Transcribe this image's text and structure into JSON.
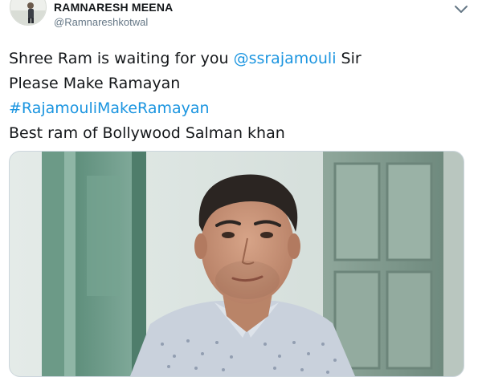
{
  "tweet": {
    "display_name": "RAMNARESH MEENA",
    "handle": "@Ramnareshkotwal",
    "text": {
      "line1_pre": "Shree Ram is waiting for you ",
      "line1_mention": "@ssrajamouli",
      "line1_post": " Sir",
      "line2": "Please Make Ramayan",
      "line3_hashtag": "#RajamouliMakeRamayan",
      "line4": "Best ram of Bollywood Salman khan"
    },
    "link_color": "#1b95e0",
    "text_color": "#14171a",
    "muted_color": "#657786"
  },
  "icons": {
    "caret": "chevron-down-icon",
    "avatar": "avatar-photo"
  }
}
